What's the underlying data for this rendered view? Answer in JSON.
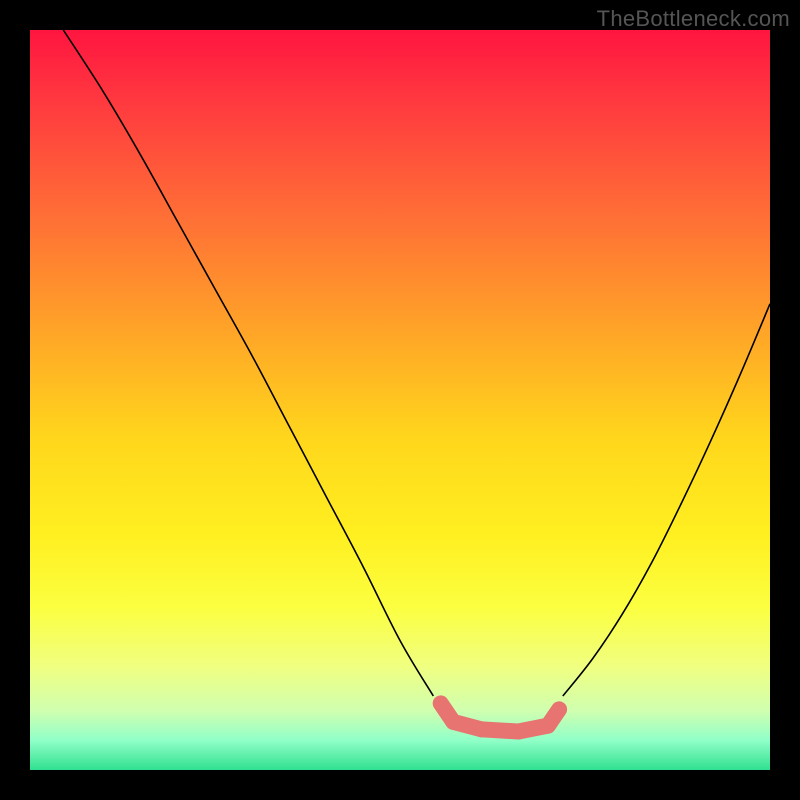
{
  "watermark": "TheBottleneck.com",
  "chart_data": {
    "type": "line",
    "title": "",
    "xlabel": "",
    "ylabel": "",
    "xlim": [
      0,
      1
    ],
    "ylim": [
      0,
      1
    ],
    "grid": false,
    "legend": false,
    "background_gradient_stops": [
      {
        "offset": 0.0,
        "color": "#ff1540"
      },
      {
        "offset": 0.1,
        "color": "#ff3a3f"
      },
      {
        "offset": 0.25,
        "color": "#ff6e36"
      },
      {
        "offset": 0.4,
        "color": "#ffa228"
      },
      {
        "offset": 0.55,
        "color": "#ffd61c"
      },
      {
        "offset": 0.68,
        "color": "#ffef20"
      },
      {
        "offset": 0.78,
        "color": "#fbff40"
      },
      {
        "offset": 0.86,
        "color": "#f0ff80"
      },
      {
        "offset": 0.92,
        "color": "#d0ffb0"
      },
      {
        "offset": 0.96,
        "color": "#90ffc8"
      },
      {
        "offset": 1.0,
        "color": "#30e090"
      }
    ],
    "series": [
      {
        "name": "left-curve",
        "x": [
          0.045,
          0.1,
          0.15,
          0.2,
          0.25,
          0.3,
          0.35,
          0.4,
          0.45,
          0.5,
          0.545
        ],
        "y": [
          1.0,
          0.915,
          0.83,
          0.74,
          0.65,
          0.56,
          0.465,
          0.37,
          0.275,
          0.175,
          0.1
        ]
      },
      {
        "name": "right-curve",
        "x": [
          0.72,
          0.76,
          0.8,
          0.84,
          0.88,
          0.92,
          0.96,
          1.0
        ],
        "y": [
          0.1,
          0.15,
          0.21,
          0.28,
          0.36,
          0.445,
          0.535,
          0.63
        ]
      }
    ],
    "markers": [
      {
        "name": "optimum-region",
        "points": [
          {
            "x": 0.555,
            "y": 0.09
          },
          {
            "x": 0.572,
            "y": 0.065
          },
          {
            "x": 0.61,
            "y": 0.055
          },
          {
            "x": 0.66,
            "y": 0.052
          },
          {
            "x": 0.7,
            "y": 0.06
          },
          {
            "x": 0.715,
            "y": 0.082
          }
        ]
      }
    ]
  }
}
